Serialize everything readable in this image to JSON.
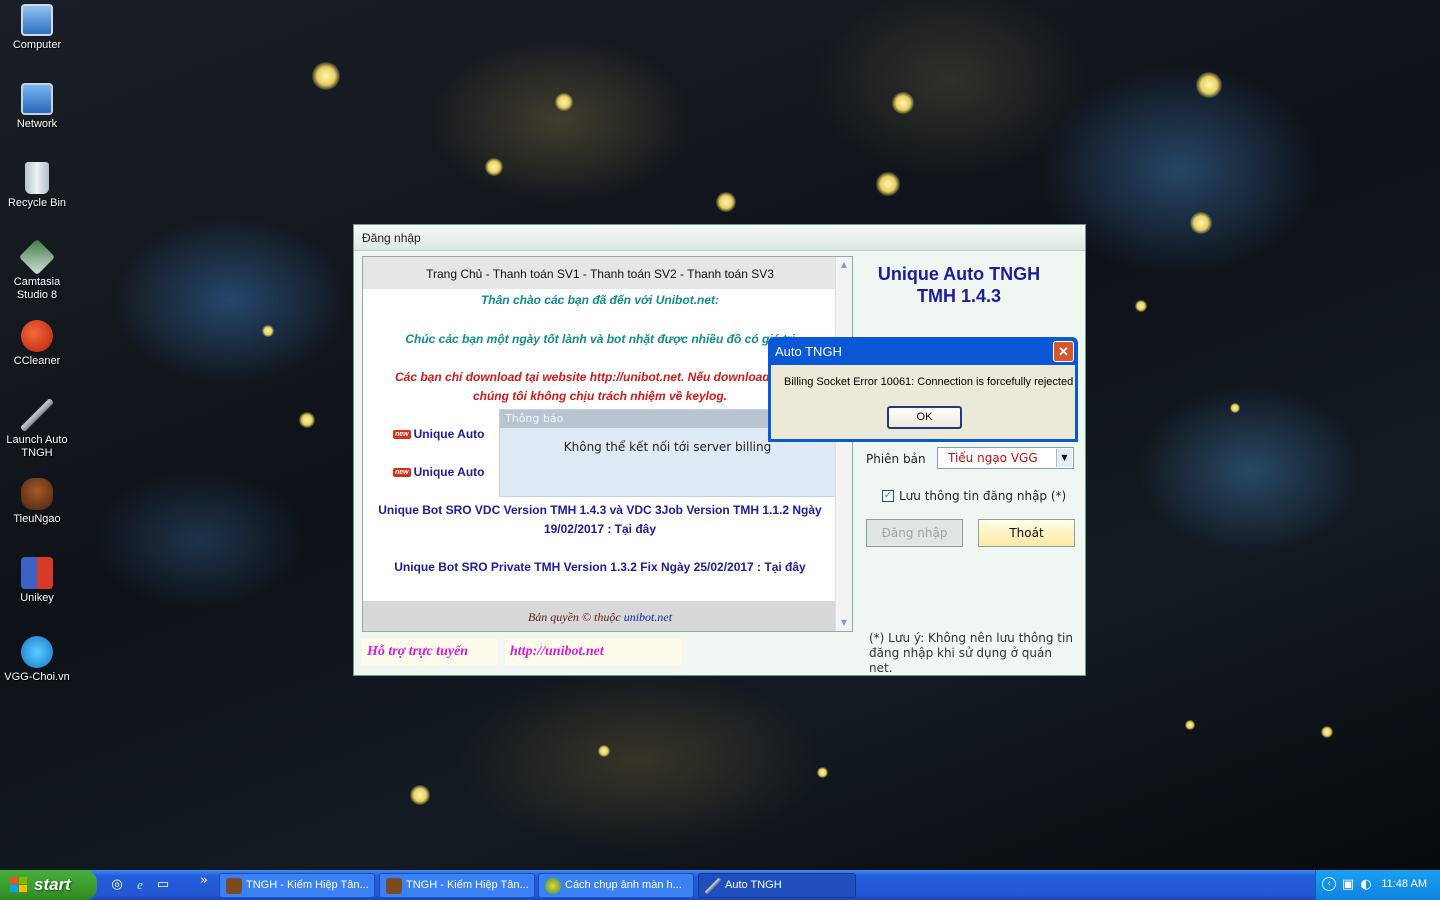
{
  "desktop": {
    "icons": [
      {
        "label": "Computer"
      },
      {
        "label": "Network"
      },
      {
        "label": "Recycle Bin"
      },
      {
        "label": "Camtasia Studio 8"
      },
      {
        "label": "CCleaner"
      },
      {
        "label": "Launch Auto TNGH"
      },
      {
        "label": "TieuNgao"
      },
      {
        "label": "Unikey"
      },
      {
        "label": "VGG-Choi.vn"
      }
    ]
  },
  "window": {
    "title": "Đăng nhập",
    "browser": {
      "nav": "Trang Chủ - Thanh toán SV1 - Thanh toán SV2 - Thanh toán SV3",
      "greeting": "Thân chào các bạn đã đến với Unibot.net:",
      "wish": "Chúc các bạn một ngày tốt lành và bot nhặt được nhiều đồ có giá trị",
      "warning_1": "Các bạn chỉ download tại website http://unibot.net. Nếu download ngoài",
      "warning_2": "chúng tôi không chịu trách nhiệm về keylog.",
      "new_badge": "new",
      "news_1": "Unique Auto",
      "news_2": "Unique Auto",
      "news_3a": "Unique Bot SRO VDC Version TMH 1.4.3 và VDC 3Job Version TMH 1.1.2 Ngày",
      "news_3b": "19/02/2017 : Tại đây",
      "news_4": "Unique Bot SRO Private TMH Version 1.3.2 Fix Ngày 25/02/2017 : Tại đây",
      "footer_prefix": "Bản quyền © thuộc",
      "footer_site": "unibot.net"
    },
    "notification": {
      "title": "Thông báo",
      "message": "Không thể kết nối tới server billing"
    },
    "support_label": "Hỗ trợ trực tuyến",
    "support_url": "http://unibot.net",
    "app_title": "Unique Auto TNGH",
    "app_version": "TMH 1.4.3",
    "version_label": "Phiên bản",
    "version_value": "Tiếu ngạo VGG",
    "remember_label": "Lưu thông tin đăng nhập (*)",
    "remember_checked": true,
    "login_button": "Đăng nhập",
    "exit_button": "Thoát",
    "note": "(*) Lưu ý:  Không nên lưu thông tin đăng nhập khi sử dụng ở quán net."
  },
  "dialog": {
    "title": "Auto TNGH",
    "message": "Billing Socket Error 10061: Connection is forcefully rejected",
    "ok": "OK"
  },
  "taskbar": {
    "start": "start",
    "quick_launch_more": "»",
    "tasks": [
      {
        "label": "TNGH - Kiếm Hiệp Tân..."
      },
      {
        "label": "TNGH - Kiếm Hiệp Tân..."
      },
      {
        "label": "Cách chụp ảnh màn h..."
      },
      {
        "label": "Auto TNGH"
      }
    ],
    "clock": "11:48 AM"
  },
  "colors": {
    "xp_blue": "#245edb",
    "start_green": "#3a9c2e",
    "link_navy": "#1c1c9c",
    "teal": "#138c8c",
    "warning_red": "#d41818",
    "exit_button_bg": "#fff1b8"
  }
}
